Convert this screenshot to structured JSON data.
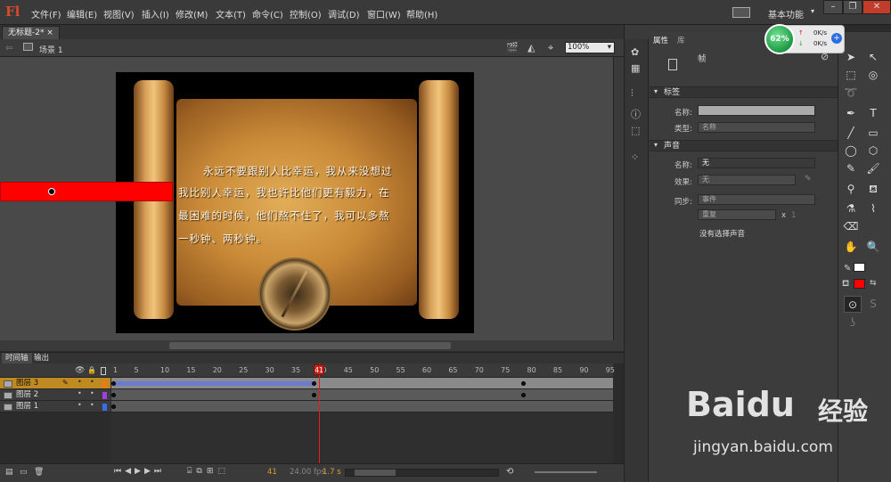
{
  "app": {
    "logo": "Fl"
  },
  "menu": [
    "文件(F)",
    "编辑(E)",
    "视图(V)",
    "插入(I)",
    "修改(M)",
    "文本(T)",
    "命令(C)",
    "控制(O)",
    "调试(D)",
    "窗口(W)",
    "帮助(H)"
  ],
  "workspace": "基本功能",
  "doc": {
    "tab": "无标题-2*",
    "tab_close": "×",
    "scene": "场景 1",
    "zoom": "100%"
  },
  "stage_text": [
    "永远不要跟别人比幸运，我从来没想过",
    "我比别人幸运，我也许比他们更有毅力，在",
    "最困难的时候，他们熬不住了，我可以多熬",
    "一秒钟、两秒钟。"
  ],
  "timeline": {
    "tab_timeline": "时间轴",
    "tab_output": "输出",
    "ruler": [
      "1",
      "5",
      "10",
      "15",
      "20",
      "25",
      "30",
      "35",
      "40",
      "45",
      "50",
      "55",
      "60",
      "65",
      "70",
      "75",
      "80",
      "85",
      "90",
      "95"
    ],
    "playhead": "41",
    "layers": [
      {
        "name": "图层 3",
        "selected": true,
        "color": "#f07a10"
      },
      {
        "name": "图层 2",
        "selected": false,
        "color": "#a040e0"
      },
      {
        "name": "图层 1",
        "selected": false,
        "color": "#3a6cf0"
      }
    ],
    "status": {
      "frame": "41",
      "fps": "24.00 fps",
      "time": "1.7 s"
    }
  },
  "panel": {
    "tab_props": "属性",
    "tab_lib": "库",
    "frame_label": "帧",
    "sec_label": "标签",
    "name_label": "名称:",
    "type_label": "类型:",
    "type_value": "名称",
    "sec_sound": "声音",
    "sound_name_label": "名称:",
    "sound_name_value": "无",
    "effect_label": "效果:",
    "effect_value": "无",
    "sync_label": "同步:",
    "sync_value": "事件",
    "repeat_value": "重复",
    "repeat_x": "x",
    "repeat_n": "1",
    "no_sound": "没有选择声音"
  },
  "net": {
    "percent": "62%",
    "up": "0K/s",
    "down": "0K/s"
  },
  "watermark": {
    "brand": "Bai",
    "paw": "du",
    "cn": "经验",
    "url": "jingyan.baidu.com"
  },
  "colors": {
    "accent": "#c08a22",
    "stroke_fill": "#ff0000"
  }
}
